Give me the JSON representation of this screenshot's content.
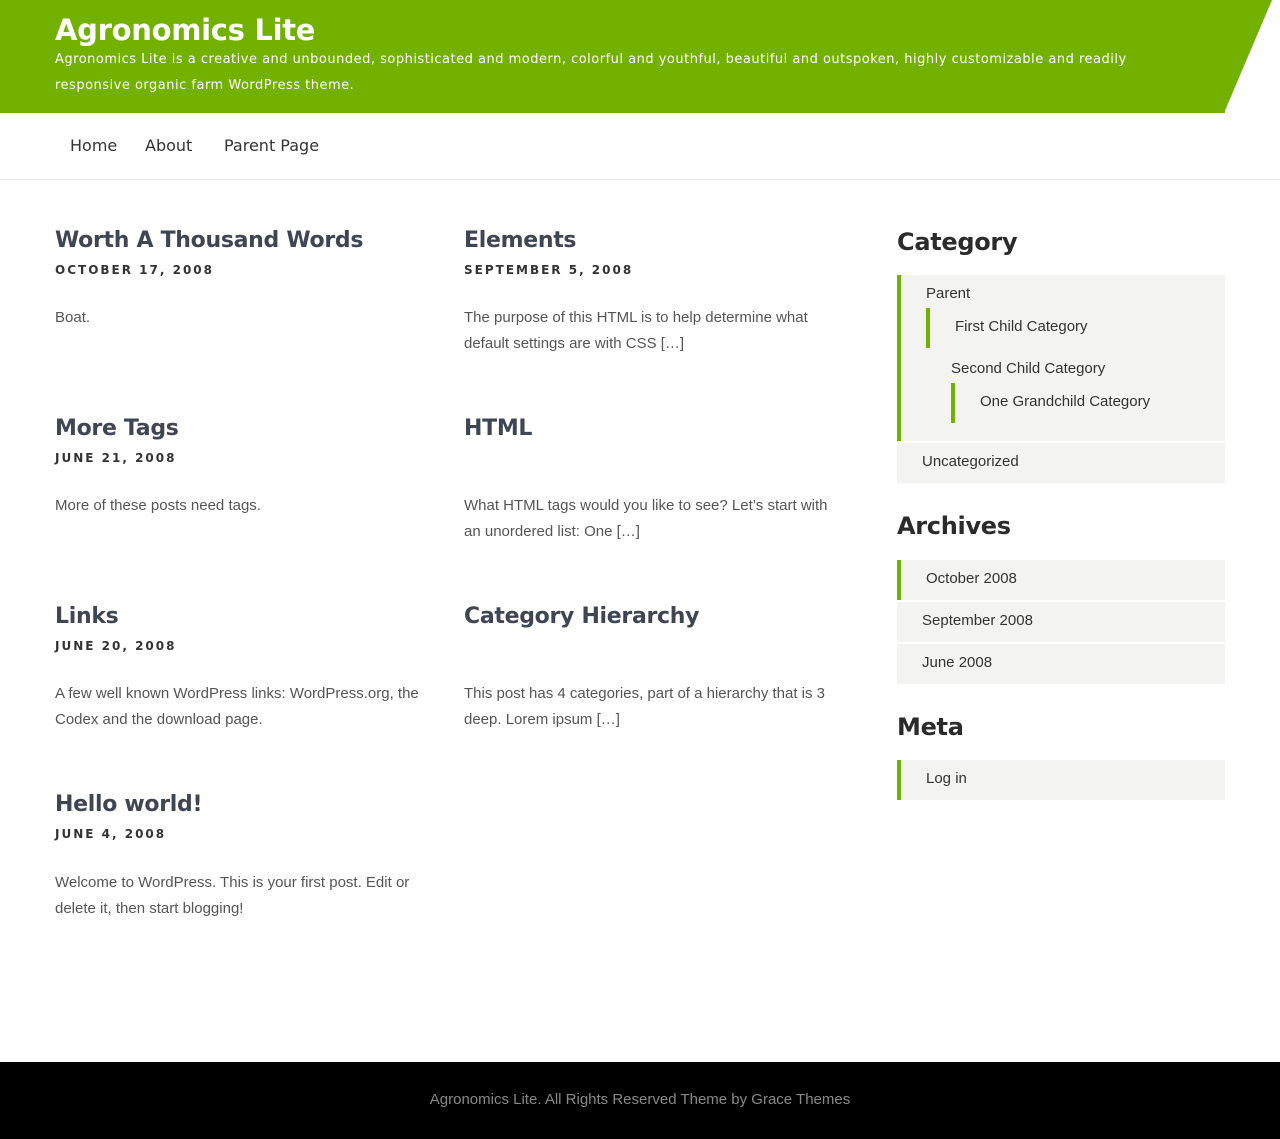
{
  "site": {
    "title": "Agronomics Lite",
    "description": "Agronomics Lite is a creative and unbounded, sophisticated and modern, colorful and youthful, beautiful and outspoken, highly customizable and readily responsive organic farm WordPress theme."
  },
  "nav": {
    "items": [
      "Home",
      "About",
      "Parent Page"
    ]
  },
  "posts": [
    {
      "title": "Worth A Thousand Words",
      "date": "OCTOBER 17, 2008",
      "excerpt": "Boat."
    },
    {
      "title": "Elements",
      "date": "SEPTEMBER 5, 2008",
      "excerpt": "The purpose of this HTML is to help determine what default settings are with CSS […]"
    },
    {
      "title": "More Tags",
      "date": "JUNE 21, 2008",
      "excerpt": "More of these posts need tags."
    },
    {
      "title": "HTML",
      "date": "",
      "excerpt": "What HTML tags would you like to see? Let’s start with an unordered list: One […]"
    },
    {
      "title": "Links",
      "date": "JUNE 20, 2008",
      "excerpt": "A few well known WordPress links: WordPress.org, the Codex and the download page."
    },
    {
      "title": "Category Hierarchy",
      "date": "",
      "excerpt": "This post has 4 categories, part of a hierarchy that is 3 deep. Lorem ipsum […]"
    },
    {
      "title": "Hello world!",
      "date": "JUNE 4, 2008",
      "excerpt": "Welcome to WordPress. This is your first post. Edit or delete it, then start blogging!"
    }
  ],
  "sidebar": {
    "category": {
      "title": "Category",
      "items": [
        "Parent",
        "First Child Category",
        "Second Child Category",
        "One Grandchild Category",
        "Uncategorized"
      ]
    },
    "archives": {
      "title": "Archives",
      "items": [
        "October 2008",
        "September 2008",
        "June 2008"
      ]
    },
    "meta": {
      "title": "Meta",
      "items": [
        "Log in"
      ]
    }
  },
  "footer": {
    "text": "Agronomics Lite. All Rights Reserved Theme by Grace Themes"
  },
  "colors": {
    "accent": "#72b100",
    "footer_bg": "#000000",
    "widget_bg": "#f3f3f1"
  }
}
